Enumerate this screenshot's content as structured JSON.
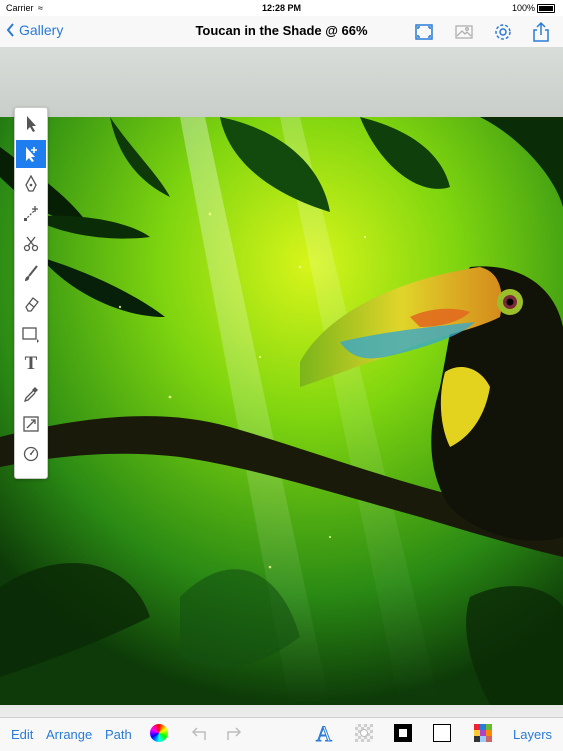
{
  "status": {
    "carrier": "Carrier",
    "time": "12:28 PM",
    "battery": "100%"
  },
  "nav": {
    "back_label": "Gallery",
    "title": "Toucan in the Shade @ 66%",
    "icons": [
      "fit-screen-icon",
      "image-icon",
      "gear-icon",
      "share-icon"
    ]
  },
  "tools": [
    {
      "name": "select-arrow-icon",
      "selected": false
    },
    {
      "name": "subselect-arrow-icon",
      "selected": true
    },
    {
      "name": "pen-icon",
      "selected": false
    },
    {
      "name": "add-point-icon",
      "selected": false
    },
    {
      "name": "scissors-icon",
      "selected": false
    },
    {
      "name": "brush-icon",
      "selected": false
    },
    {
      "name": "eraser-icon",
      "selected": false
    },
    {
      "name": "rectangle-shape-icon",
      "selected": false
    },
    {
      "name": "text-tool-icon",
      "selected": false
    },
    {
      "name": "eyedropper-icon",
      "selected": false
    },
    {
      "name": "scale-icon",
      "selected": false
    },
    {
      "name": "rotate-icon",
      "selected": false
    }
  ],
  "toolbar": {
    "edit_label": "Edit",
    "arrange_label": "Arrange",
    "path_label": "Path",
    "layers_label": "Layers",
    "text_tool_glyph": "T",
    "font_glyph": "A"
  },
  "colors": {
    "accent": "#2a7ad8",
    "selected_tool": "#1e7ef0"
  }
}
